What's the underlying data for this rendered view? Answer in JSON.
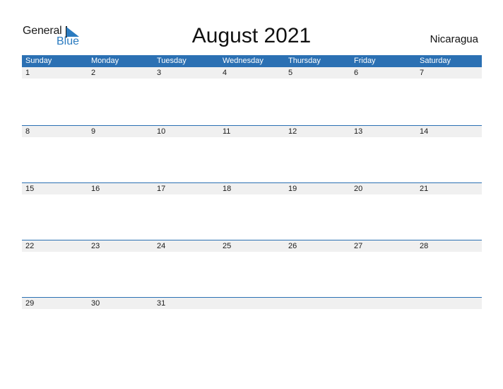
{
  "logo": {
    "word1": "General",
    "word2": "Blue"
  },
  "title": "August 2021",
  "country": "Nicaragua",
  "colors": {
    "header": "#2b70b3",
    "accent": "#2b7bc0",
    "strip": "#f0f0f0"
  },
  "weekdays": [
    "Sunday",
    "Monday",
    "Tuesday",
    "Wednesday",
    "Thursday",
    "Friday",
    "Saturday"
  ],
  "weeks": [
    [
      "1",
      "2",
      "3",
      "4",
      "5",
      "6",
      "7"
    ],
    [
      "8",
      "9",
      "10",
      "11",
      "12",
      "13",
      "14"
    ],
    [
      "15",
      "16",
      "17",
      "18",
      "19",
      "20",
      "21"
    ],
    [
      "22",
      "23",
      "24",
      "25",
      "26",
      "27",
      "28"
    ],
    [
      "29",
      "30",
      "31",
      "",
      "",
      "",
      ""
    ]
  ]
}
